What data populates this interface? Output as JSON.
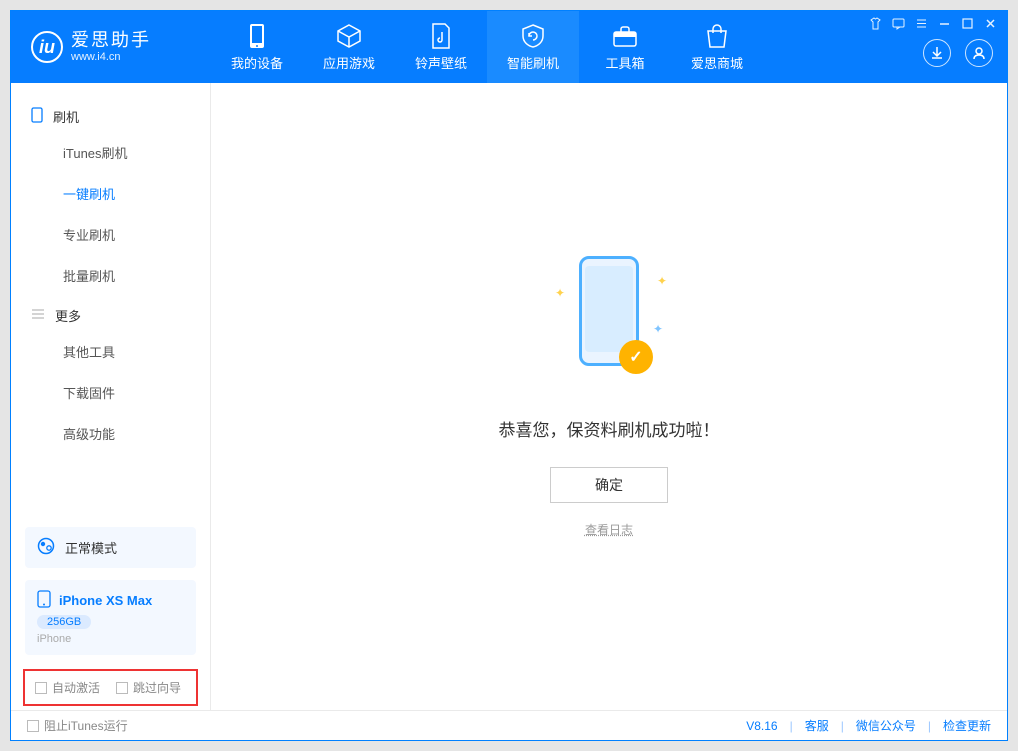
{
  "app": {
    "name": "爱思助手",
    "url": "www.i4.cn"
  },
  "nav": [
    {
      "label": "我的设备"
    },
    {
      "label": "应用游戏"
    },
    {
      "label": "铃声壁纸"
    },
    {
      "label": "智能刷机"
    },
    {
      "label": "工具箱"
    },
    {
      "label": "爱思商城"
    }
  ],
  "sidebar": {
    "group1": "刷机",
    "items1": [
      {
        "label": "iTunes刷机"
      },
      {
        "label": "一键刷机"
      },
      {
        "label": "专业刷机"
      },
      {
        "label": "批量刷机"
      }
    ],
    "group2": "更多",
    "items2": [
      {
        "label": "其他工具"
      },
      {
        "label": "下载固件"
      },
      {
        "label": "高级功能"
      }
    ]
  },
  "mode": {
    "label": "正常模式"
  },
  "device": {
    "name": "iPhone XS Max",
    "storage": "256GB",
    "type": "iPhone"
  },
  "bottom_opts": {
    "auto_activate": "自动激活",
    "skip_guide": "跳过向导"
  },
  "main": {
    "success_text": "恭喜您，保资料刷机成功啦！",
    "ok": "确定",
    "view_log": "查看日志"
  },
  "footer": {
    "block_itunes": "阻止iTunes运行",
    "version": "V8.16",
    "support": "客服",
    "wechat": "微信公众号",
    "update": "检查更新"
  }
}
